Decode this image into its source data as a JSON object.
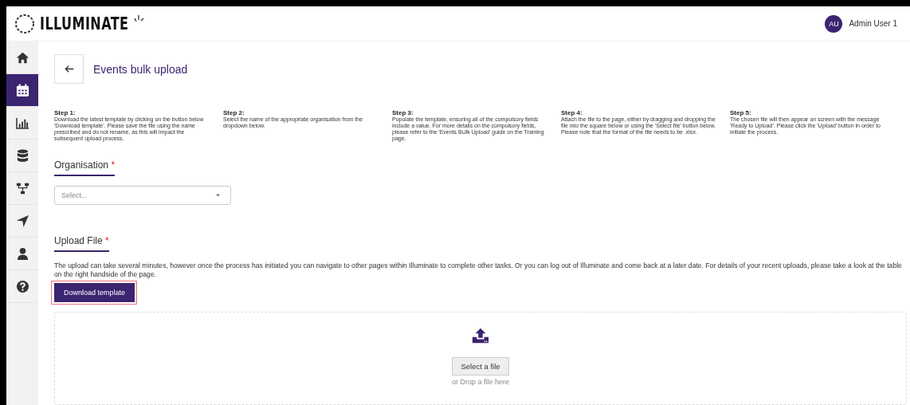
{
  "header": {
    "app_name": "ILLUMINATE",
    "user": {
      "initials": "AU",
      "name": "Admin User 1"
    }
  },
  "sidebar": {
    "items": [
      {
        "kind": "home",
        "selected": false
      },
      {
        "kind": "calendar",
        "selected": true
      },
      {
        "kind": "chart",
        "selected": false
      },
      {
        "kind": "database",
        "selected": false
      },
      {
        "kind": "hierarchy",
        "selected": false
      },
      {
        "kind": "send",
        "selected": false
      },
      {
        "kind": "person",
        "selected": false
      },
      {
        "kind": "help",
        "selected": false
      }
    ]
  },
  "page": {
    "title": "Events bulk upload"
  },
  "steps": [
    {
      "title": "Step 1:",
      "text": "Download the latest template by clicking on the button below 'Download template'. Please save the file using the name prescribed and do not rename, as this will impact the subsequent upload process."
    },
    {
      "title": "Step 2:",
      "text": "Select the name of the appropriate organisation from the dropdown below."
    },
    {
      "title": "Step 3:",
      "text": "Populate the template, ensuring all of the compulsory fields include a value. For more details on the compulsory fields, please refer to the 'Events BUlk Upload' guide on the Training page."
    },
    {
      "title": "Step 4:",
      "text": "Attach the file to the page, either by dragging and dropping the file into the square below or using the 'Select file' button below. Please note that the format of the file needs to be .xlsx."
    },
    {
      "title": "Step 5:",
      "text": "The chosen file will then appear on screen with the message 'Ready to Upload'. Please click the 'Upload' button in order to initiate the process."
    }
  ],
  "organisation": {
    "label": "Organisation",
    "required_mark": "*",
    "placeholder": "Select..."
  },
  "upload": {
    "label": "Upload File",
    "required_mark": "*",
    "description": "The upload can take several minutes, however once the process has initiated you can navigate to other pages within Illuminate to complete other tasks. Or you can log out of Illuminate and come back at a later date. For details of your recent uploads, please take a look at the table on the right handside of the page.",
    "download_button": "Download template",
    "highlighted": true,
    "select_button": "Select a file",
    "drop_hint": "or Drop a file here"
  }
}
